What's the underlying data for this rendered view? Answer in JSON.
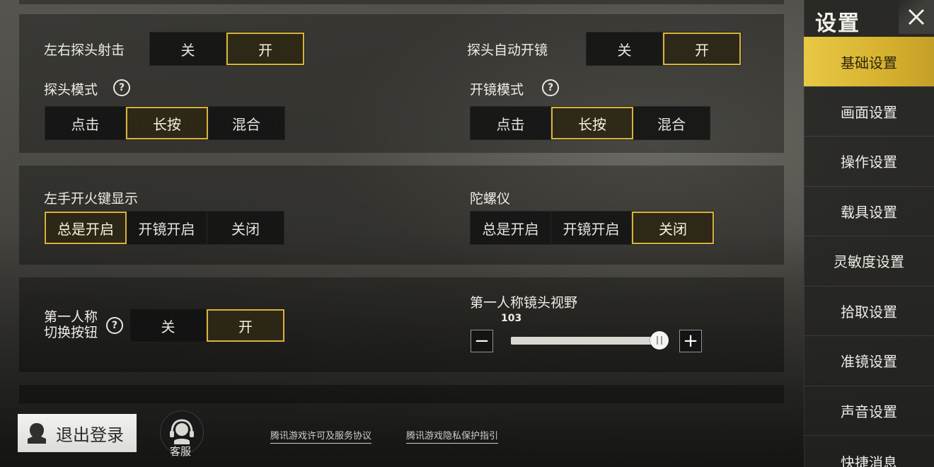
{
  "sidebar": {
    "title": "设置",
    "items": [
      {
        "label": "基础设置",
        "active": true
      },
      {
        "label": "画面设置",
        "active": false
      },
      {
        "label": "操作设置",
        "active": false
      },
      {
        "label": "载具设置",
        "active": false
      },
      {
        "label": "灵敏度设置",
        "active": false
      },
      {
        "label": "拾取设置",
        "active": false
      },
      {
        "label": "准镜设置",
        "active": false
      },
      {
        "label": "声音设置",
        "active": false
      },
      {
        "label": "快捷消息",
        "active": false
      }
    ]
  },
  "section1": {
    "lean_fire": {
      "label": "左右探头射击",
      "options": [
        "关",
        "开"
      ],
      "selected": "开"
    },
    "lean_auto_scope": {
      "label": "探头自动开镜",
      "options": [
        "关",
        "开"
      ],
      "selected": "开"
    },
    "lean_mode": {
      "label": "探头模式",
      "options": [
        "点击",
        "长按",
        "混合"
      ],
      "selected": "长按"
    },
    "scope_mode": {
      "label": "开镜模式",
      "options": [
        "点击",
        "长按",
        "混合"
      ],
      "selected": "长按"
    }
  },
  "section2": {
    "left_fire": {
      "label": "左手开火键显示",
      "options": [
        "总是开启",
        "开镜开启",
        "关闭"
      ],
      "selected": "总是开启"
    },
    "gyroscope": {
      "label": "陀螺仪",
      "options": [
        "总是开启",
        "开镜开启",
        "关闭"
      ],
      "selected": "关闭"
    }
  },
  "section3": {
    "fpp_toggle": {
      "label_line1": "第一人称",
      "label_line2": "切换按钮",
      "options": [
        "关",
        "开"
      ],
      "selected": "开"
    },
    "fpp_fov": {
      "label": "第一人称镜头视野",
      "value": "103",
      "fraction": 0.97
    }
  },
  "footer": {
    "logout_label": "退出登录",
    "service_label": "客服",
    "license_link": "腾讯游戏许可及服务协议",
    "privacy_link": "腾讯游戏隐私保护指引"
  },
  "colors": {
    "accent": "#d7b338",
    "active_tab": "#e2bf3c"
  }
}
